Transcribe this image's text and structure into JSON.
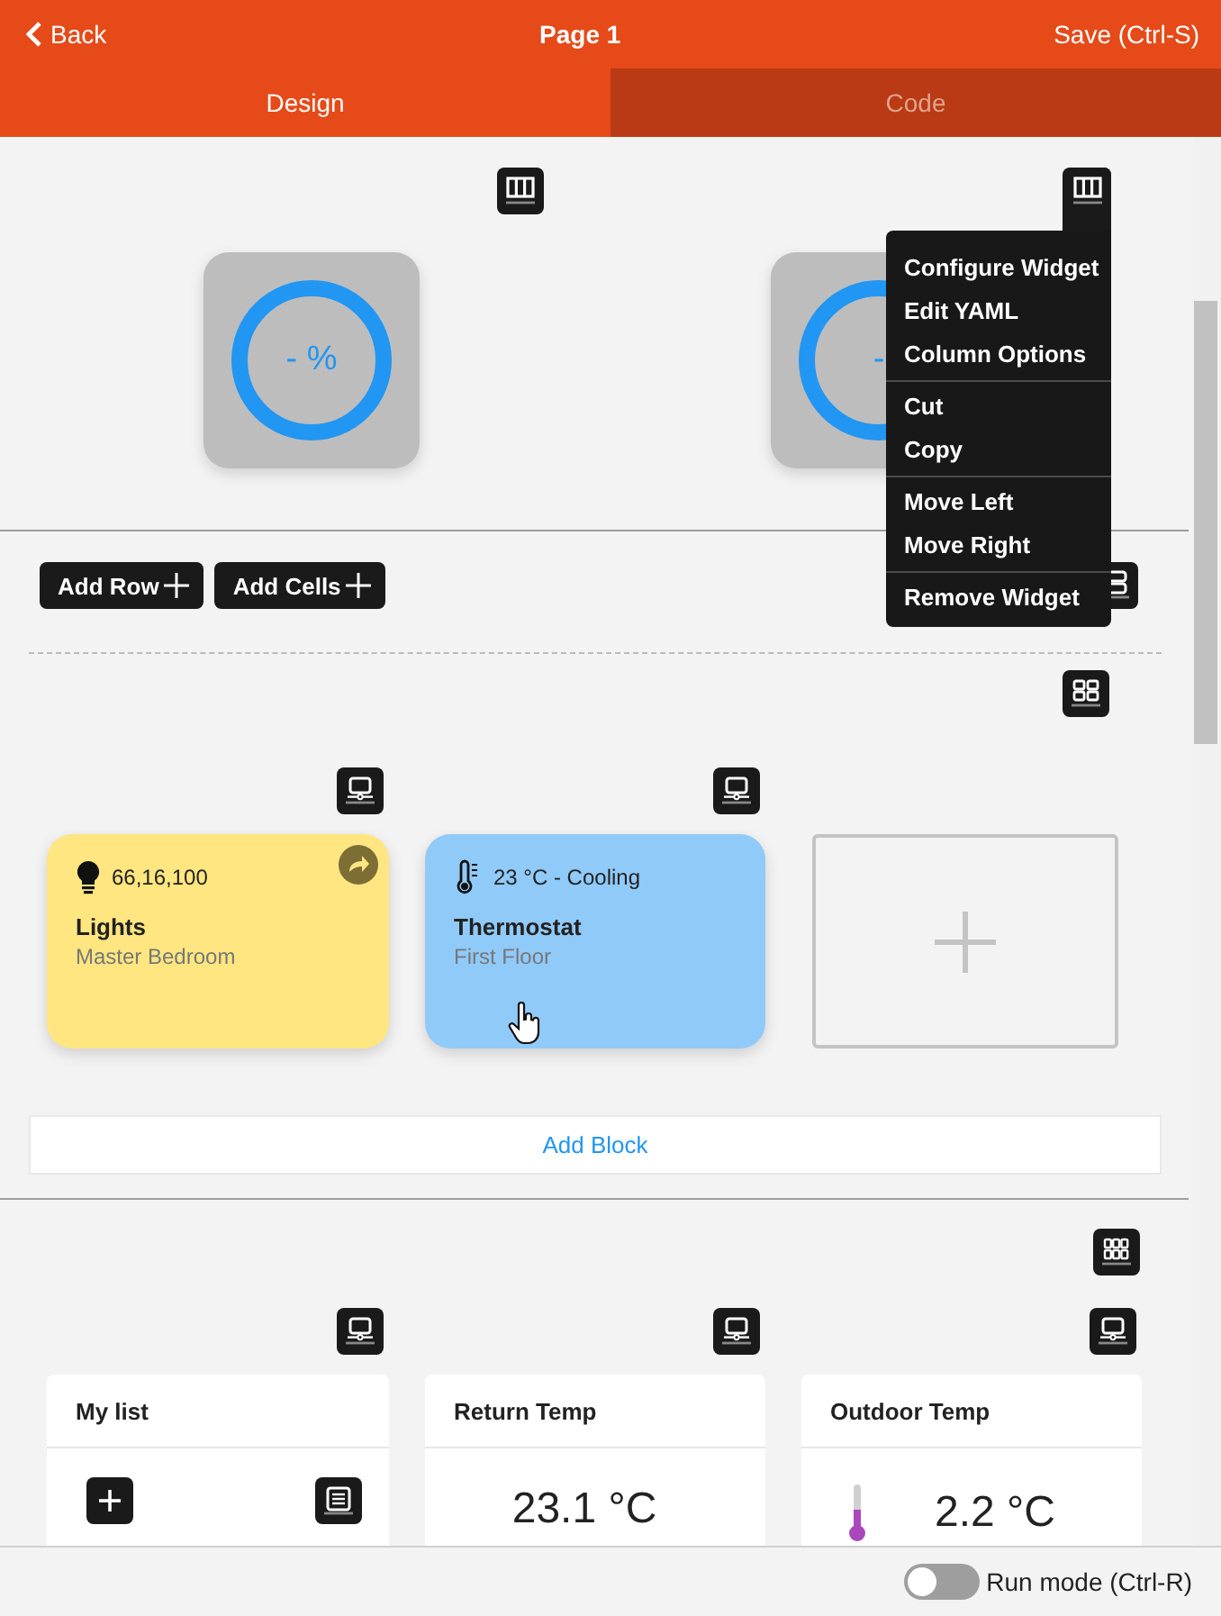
{
  "header": {
    "back": "Back",
    "title": "Page 1",
    "save": "Save (Ctrl-S)"
  },
  "tabs": [
    {
      "label": "Design",
      "selected": true
    },
    {
      "label": "Code",
      "selected": false
    }
  ],
  "gauges": [
    {
      "value": "- %"
    },
    {
      "value": "-"
    }
  ],
  "context_menu": {
    "groups": [
      [
        "Configure Widget",
        "Edit YAML",
        "Column Options"
      ],
      [
        "Cut",
        "Copy"
      ],
      [
        "Move Left",
        "Move Right"
      ],
      [
        "Remove Widget"
      ]
    ]
  },
  "toolbar": {
    "buttons": [
      "Add Row",
      "Add Cells"
    ]
  },
  "tiles": [
    {
      "kind": "light",
      "state": "66,16,100",
      "title": "Lights",
      "subtitle": "Master Bedroom",
      "color": "#ffe680"
    },
    {
      "kind": "thermostat",
      "state": "23 °C - Cooling",
      "title": "Thermostat",
      "subtitle": "First Floor",
      "color": "#90caf9"
    },
    {
      "kind": "add"
    }
  ],
  "add_block": "Add Block",
  "cards": [
    {
      "kind": "list",
      "title": "My list"
    },
    {
      "kind": "value",
      "title": "Return Temp",
      "value": "23.1 °C"
    },
    {
      "kind": "thermometer",
      "title": "Outdoor Temp",
      "value": "2.2 °C"
    }
  ],
  "footer": {
    "run_mode": {
      "label": "Run mode (Ctrl-R)",
      "on": false
    }
  }
}
